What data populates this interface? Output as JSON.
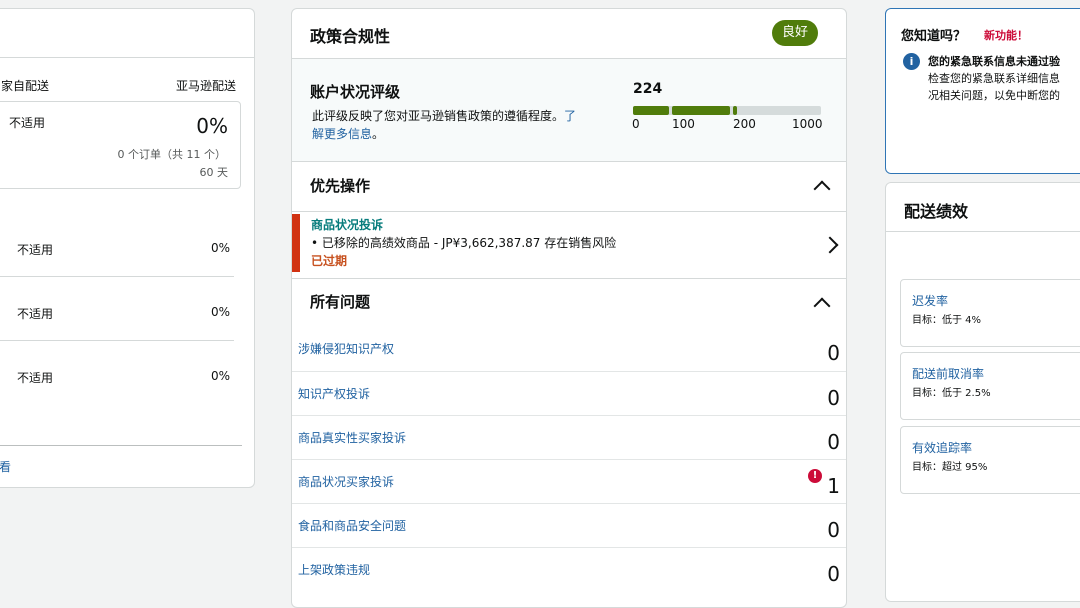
{
  "left": {
    "col_self": "家自配送",
    "col_amazon": "亚马逊配送",
    "box_na": "不适用",
    "box_pct": "0%",
    "box_orders": "0 个订单（共 11 个）",
    "box_days": "60 天",
    "rows": [
      {
        "na": "不适用",
        "pct": "0%"
      },
      {
        "na": "不适用",
        "pct": "0%"
      },
      {
        "na": "不适用",
        "pct": "0%"
      }
    ],
    "footer_link": "看"
  },
  "compliance": {
    "title": "政策合规性",
    "badge": "良好",
    "rating_title": "账户状况评级",
    "rating_desc_1": "此评级反映了您对亚马逊销售政策的遵循程度。",
    "rating_desc_link_1": "了",
    "rating_desc_link_2": "解更多信息",
    "rating_desc_end": "。",
    "score": 224,
    "ticks": [
      "0",
      "100",
      "200",
      "1000"
    ],
    "priority_title": "优先操作",
    "priority_item": {
      "title": "商品状况投诉",
      "detail": "• 已移除的高绩效商品 - JP¥3,662,387.87 存在销售风险",
      "status": "已过期"
    },
    "issues_title": "所有问题",
    "issues": [
      {
        "label": "涉嫌侵犯知识产权",
        "count": "0"
      },
      {
        "label": "知识产权投诉",
        "count": "0"
      },
      {
        "label": "商品真实性买家投诉",
        "count": "0"
      },
      {
        "label": "商品状况买家投诉",
        "count": "1",
        "alert": "!"
      },
      {
        "label": "食品和商品安全问题",
        "count": "0"
      },
      {
        "label": "上架政策违规",
        "count": "0"
      }
    ]
  },
  "tip": {
    "title": "您知道吗？",
    "new_label": "新功能！",
    "info_icon_glyph": "i",
    "line1": "您的紧急联系信息未通过验",
    "line2": "检查您的紧急联系详细信息",
    "line3": "况相关问题，以免中断您的"
  },
  "shipping": {
    "title": "配送绩效",
    "metrics": [
      {
        "name": "迟发率",
        "target": "目标：低于 4%"
      },
      {
        "name": "配送前取消率",
        "target": "目标：低于 2.5%"
      },
      {
        "name": "有效追踪率",
        "target": "目标：超过 95%"
      }
    ]
  },
  "colors": {
    "good_green": "#507c0b",
    "link_blue": "#2162a1",
    "alert_red": "#cc0c39",
    "expired_red": "#c7511f"
  }
}
